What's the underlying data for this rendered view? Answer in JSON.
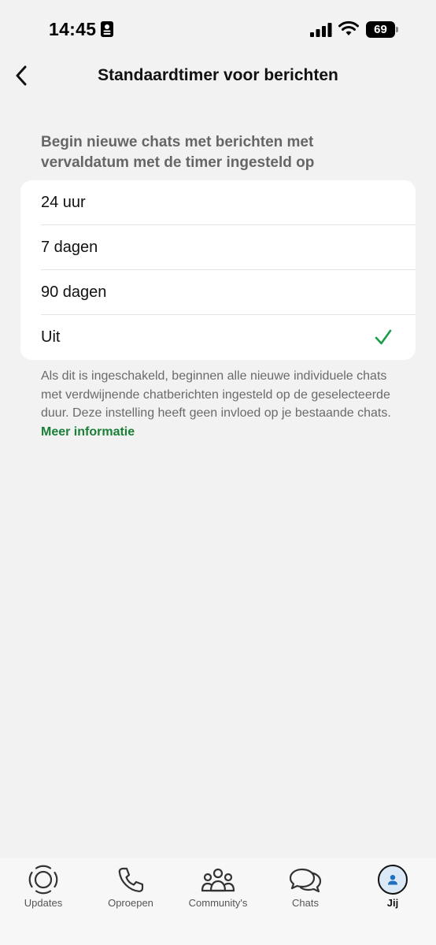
{
  "status_bar": {
    "time": "14:45",
    "battery": "69"
  },
  "nav": {
    "back_icon": "chevron-left-icon",
    "title": "Standaardtimer voor berichten"
  },
  "section_header": "Begin nieuwe chats met berichten met vervaldatum met de timer ingesteld op",
  "options": [
    {
      "label": "24 uur",
      "selected": false
    },
    {
      "label": "7 dagen",
      "selected": false
    },
    {
      "label": "90 dagen",
      "selected": false
    },
    {
      "label": "Uit",
      "selected": true
    }
  ],
  "footer": {
    "text": "Als dit is ingeschakeld, beginnen alle nieuwe individuele chats met verdwijnende chatberichten ingesteld op de geselecteerde duur. Deze instelling heeft geen invloed op je bestaande chats.",
    "link": "Meer informatie"
  },
  "tabs": [
    {
      "label": "Updates",
      "icon": "updates-icon",
      "active": false
    },
    {
      "label": "Oproepen",
      "icon": "phone-icon",
      "active": false
    },
    {
      "label": "Community's",
      "icon": "community-icon",
      "active": false
    },
    {
      "label": "Chats",
      "icon": "chats-icon",
      "active": false
    },
    {
      "label": "Jij",
      "icon": "avatar-icon",
      "active": true
    }
  ],
  "colors": {
    "accent": "#1a7f37",
    "background": "#f2f2f2",
    "card": "#ffffff"
  }
}
